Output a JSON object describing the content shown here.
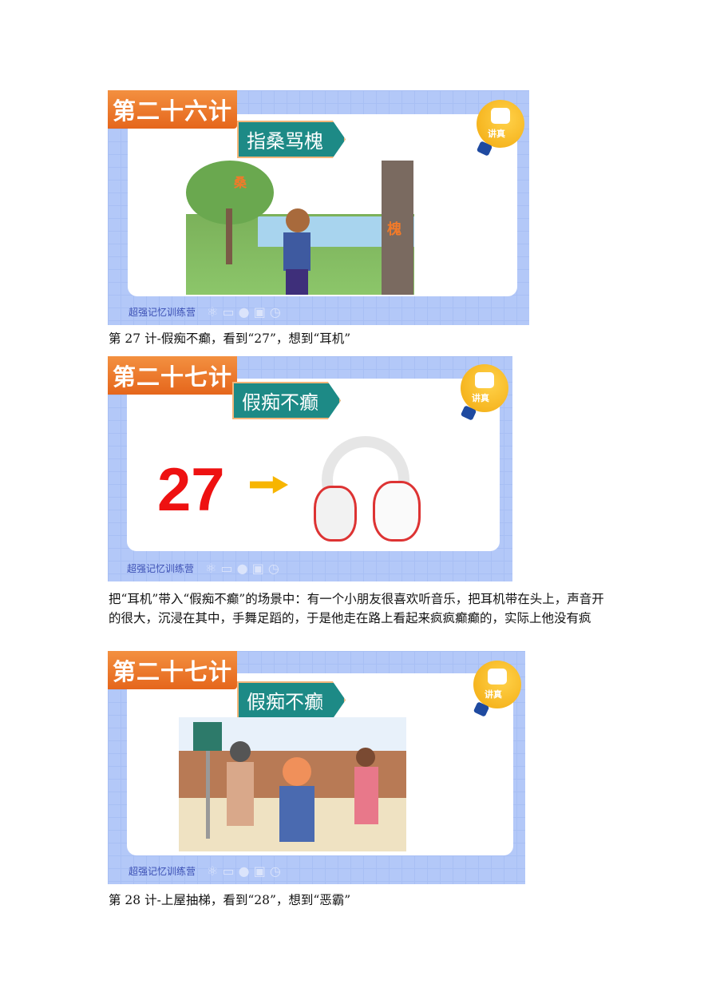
{
  "cards": [
    {
      "tag": "第二十六计",
      "title": "指桑骂槐",
      "badge": "讲真",
      "footer": "超强记忆训练营",
      "labels": [
        "桑",
        "槐"
      ]
    },
    {
      "tag": "第二十七计",
      "title": "假痴不癫",
      "badge": "讲真",
      "footer": "超强记忆训练营",
      "number": "27"
    },
    {
      "tag": "第二十七计",
      "title": "假痴不癫",
      "badge": "讲真",
      "footer": "超强记忆训练营"
    }
  ],
  "captions": [
    "第 27 计-假痴不癫，看到“27”，想到“耳机”",
    "第 28 计-上屋抽梯，看到“28”，想到“恶霸”"
  ],
  "paragraph": "把“耳机”带入“假痴不癫”的场景中：有一个小朋友很喜欢听音乐，把耳机带在头上，声音开的很大，沉浸在其中，手舞足蹈的，于是他走在路上看起来疯疯癫癫的，实际上他没有疯"
}
